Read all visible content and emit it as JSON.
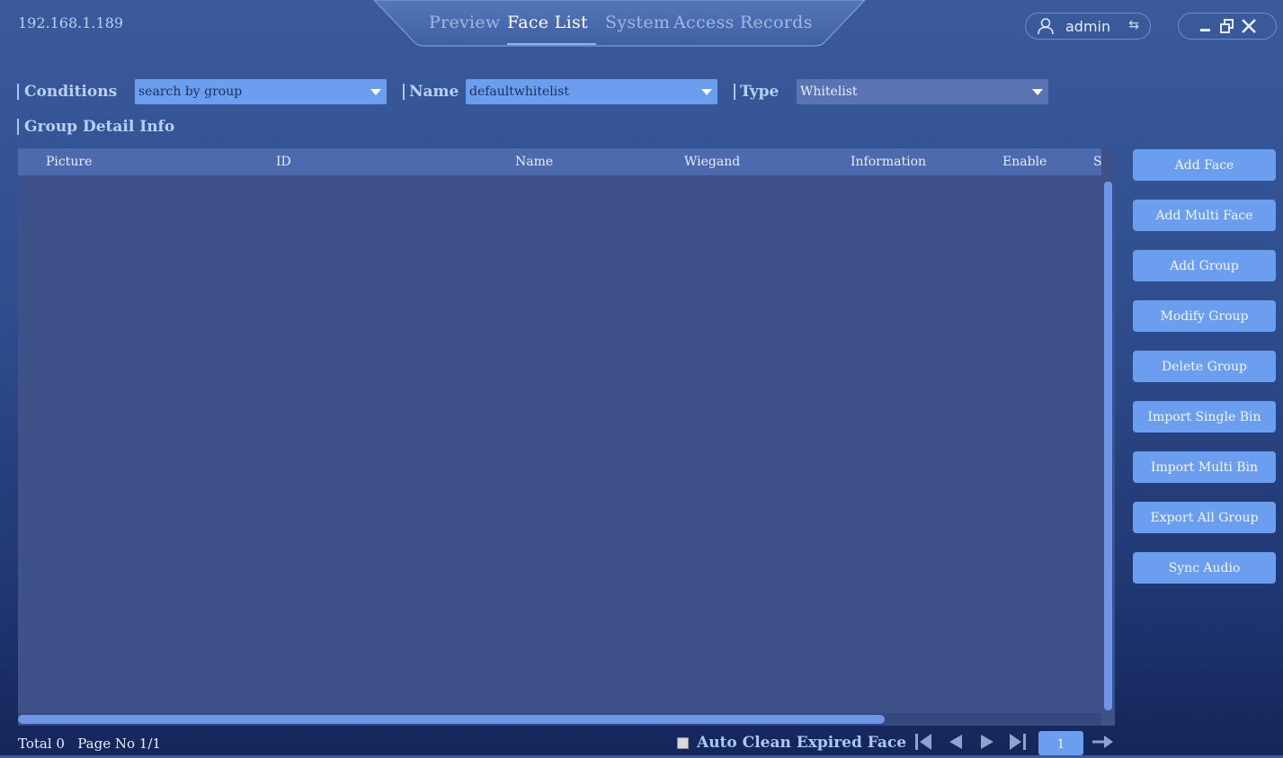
{
  "header": {
    "ip": "192.168.1.189",
    "tabs": [
      {
        "label": "Preview",
        "active": false
      },
      {
        "label": "Face List",
        "active": true
      },
      {
        "label": "System",
        "active": false
      },
      {
        "label": "Access Records",
        "active": false
      }
    ],
    "user": "admin"
  },
  "filters": {
    "conditions_label": "Conditions",
    "conditions_value": "search by group",
    "name_label": "Name",
    "name_value": "defaultwhitelist",
    "type_label": "Type",
    "type_value": "Whitelist"
  },
  "section_title": "Group Detail Info",
  "table": {
    "columns": [
      "Picture",
      "ID",
      "Name",
      "Wiegand",
      "Information",
      "Enable",
      "S"
    ],
    "rows": []
  },
  "buttons": [
    "Add Face",
    "Add Multi Face",
    "Add Group",
    "Modify Group",
    "Delete Group",
    "Import Single Bin",
    "Import Multi Bin",
    "Export All Group",
    "Sync Audio"
  ],
  "footer": {
    "total_text": "Total 0",
    "page_text": "Page No 1/1",
    "auto_clean_label": "Auto Clean Expired Face",
    "auto_clean_checked": false,
    "page_input": "1"
  },
  "colors": {
    "accent": "#6c9ef0",
    "header_row": "#4e6aae",
    "table_bg": "#3e5289"
  }
}
